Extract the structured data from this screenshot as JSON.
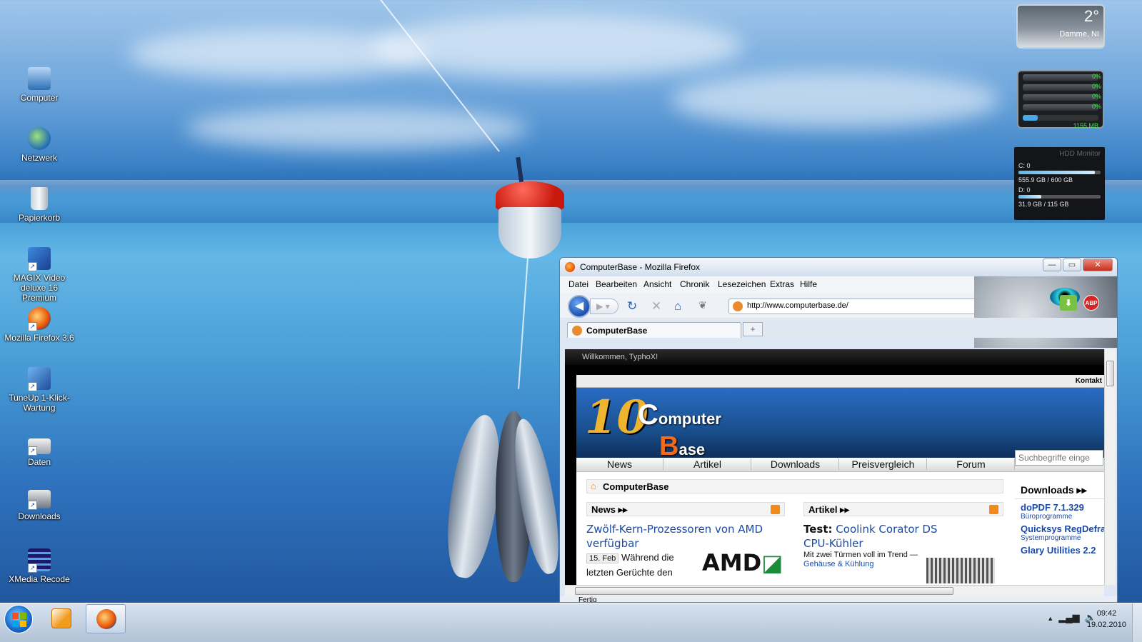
{
  "desktop": {
    "icons": [
      {
        "label": "Computer",
        "icon": "computer-icon"
      },
      {
        "label": "Netzwerk",
        "icon": "network-icon"
      },
      {
        "label": "Papierkorb",
        "icon": "recycle-bin-icon"
      },
      {
        "label": "MAGIX Video deluxe 16 Premium",
        "icon": "magix-icon"
      },
      {
        "label": "Mozilla Firefox 3.6",
        "icon": "firefox-icon"
      },
      {
        "label": "TuneUp 1-Klick-Wartung",
        "icon": "tuneup-icon"
      },
      {
        "label": "Daten",
        "icon": "drive-icon"
      },
      {
        "label": "Downloads",
        "icon": "drive-icon"
      },
      {
        "label": "XMedia Recode",
        "icon": "video-film-icon"
      }
    ]
  },
  "gadgets": {
    "weather": {
      "temp": "2°",
      "city": "Damme, NI"
    },
    "cpu": {
      "cores": [
        "0%",
        "0%",
        "0%",
        "0%"
      ],
      "memory": "1155 MB",
      "memory_fraction": 0.2
    },
    "hdd": {
      "title": "HDD Monitor",
      "drives": [
        {
          "label": "C: 0",
          "usage": "555.9 GB / 600 GB",
          "fraction": 0.93
        },
        {
          "label": "D: 0",
          "usage": "31.9 GB / 115 GB",
          "fraction": 0.28
        }
      ]
    }
  },
  "firefox": {
    "title": "ComputerBase - Mozilla Firefox",
    "window_buttons": {
      "minimize": "—",
      "maximize": "▭",
      "close": "✕"
    },
    "menu": [
      "Datei",
      "Bearbeiten",
      "Ansicht",
      "Chronik",
      "Lesezeichen",
      "Extras",
      "Hilfe"
    ],
    "url": "http://www.computerbase.de/",
    "tab": {
      "label": "ComputerBase"
    },
    "newtab": "+",
    "abp": "ABP",
    "status": "Fertig",
    "page": {
      "welcome": "Willkommen, TyphoX!",
      "kontakt": "Kontakt",
      "logo": {
        "num": "10",
        "c": "C",
        "omputer": "omputer",
        "b": "B",
        "ase": "ase"
      },
      "nav": [
        "News",
        "Artikel",
        "Downloads",
        "Preisvergleich",
        "Forum"
      ],
      "search_placeholder": "Suchbegriffe einge",
      "breadcrumb": "ComputerBase",
      "news": {
        "header": "News ▸▸",
        "headline": "Zwölf-Kern-Prozessoren von AMD verfügbar",
        "date": "15. Feb",
        "teaser": "Während die letzten Gerüchte den",
        "brand": "AMD"
      },
      "artikel": {
        "header": "Artikel ▸▸",
        "headline_prefix": "Test:",
        "headline": "Coolink Corator DS CPU-Kühler",
        "teaser": "Mit zwei Türmen voll im Trend —",
        "category": "Gehäuse & Kühlung"
      },
      "downloads": {
        "header": "Downloads ▸▸",
        "items": [
          {
            "name": "doPDF 7.1.329",
            "category": "Büroprogramme"
          },
          {
            "name": "Quicksys RegDefrag",
            "category": "Systemprogramme"
          },
          {
            "name": "Glary Utilities 2.2",
            "category": ""
          }
        ]
      }
    }
  },
  "taskbar": {
    "time": "09:42",
    "date": "19.02.2010",
    "tray_arrow": "▲"
  }
}
